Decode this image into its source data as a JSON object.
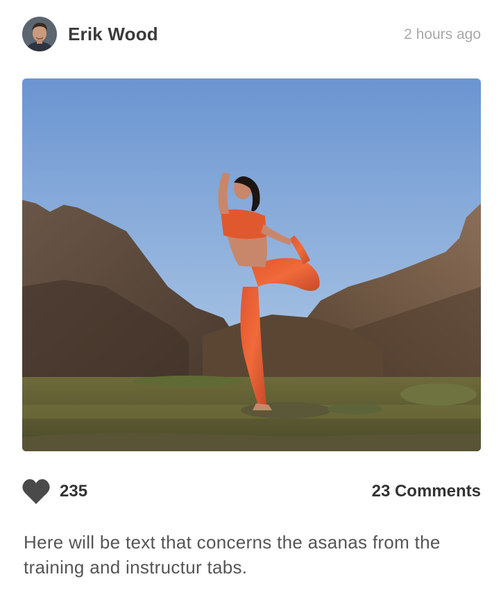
{
  "post": {
    "author": {
      "name": "Erik Wood",
      "avatar_icon": "user-avatar"
    },
    "timestamp": "2 hours ago",
    "photo": {
      "icon": "photo-yoga-pose-rocks"
    },
    "likes": {
      "icon": "heart-icon",
      "count": "235"
    },
    "comments": {
      "label": "23 Comments"
    },
    "caption": "Here will be text that concerns the asanas from the training and instructur tabs."
  },
  "colors": {
    "text_primary": "#333333",
    "text_muted": "#a8a8a8",
    "heart": "#4a4a4a",
    "sky_top": "#6b95d1",
    "sky_bottom": "#bcd3ea"
  }
}
